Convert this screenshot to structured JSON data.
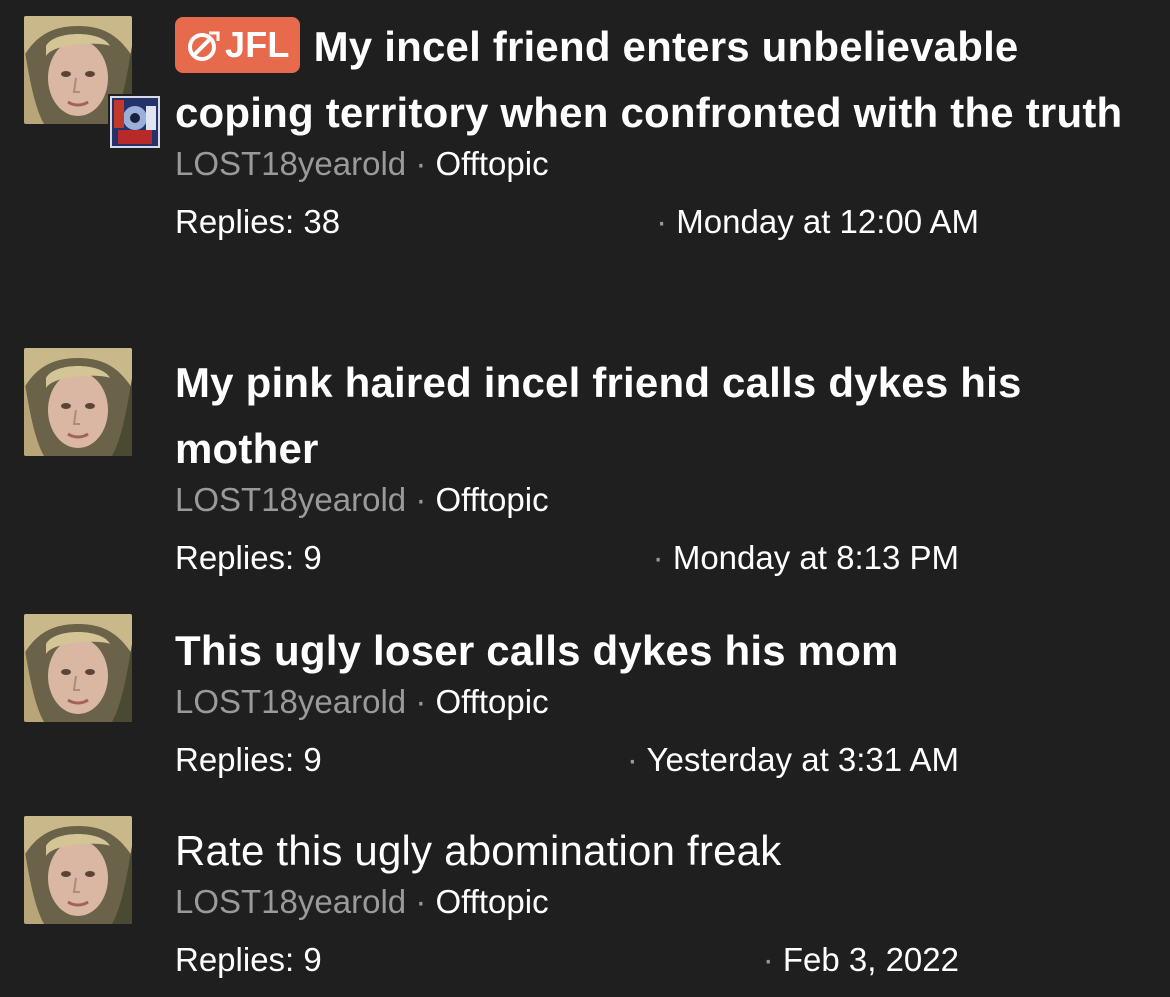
{
  "threads": [
    {
      "prefix": "JFL",
      "title": "My incel friend enters unbelievable coping territory when confronted with the truth",
      "author": "LOST18yearold",
      "forum": "Offtopic",
      "replies": "Replies: 38",
      "date": "Monday at 12:00 AM",
      "unread": true
    },
    {
      "title": "My pink haired incel friend calls dykes his mother",
      "author": "LOST18yearold",
      "forum": "Offtopic",
      "replies": "Replies: 9",
      "date": "Monday at 8:13 PM",
      "unread": true
    },
    {
      "title": "This ugly loser calls dykes his mom",
      "author": "LOST18yearold",
      "forum": "Offtopic",
      "replies": "Replies: 9",
      "date": "Yesterday at 3:31 AM",
      "unread": true
    },
    {
      "title": "Rate this ugly abomination freak",
      "author": "LOST18yearold",
      "forum": "Offtopic",
      "replies": "Replies: 9",
      "date": "Feb 3, 2022",
      "unread": false
    }
  ],
  "separator": "·",
  "colors": {
    "background": "#1f1f20",
    "prefix_bg": "#e86a4c",
    "muted_text": "#9a9a9a",
    "text": "#ffffff"
  },
  "icons": {
    "prefix_icon": "no-symbol-icon",
    "avatar": "user-avatar",
    "last_poster_avatar": "last-poster-avatar"
  }
}
